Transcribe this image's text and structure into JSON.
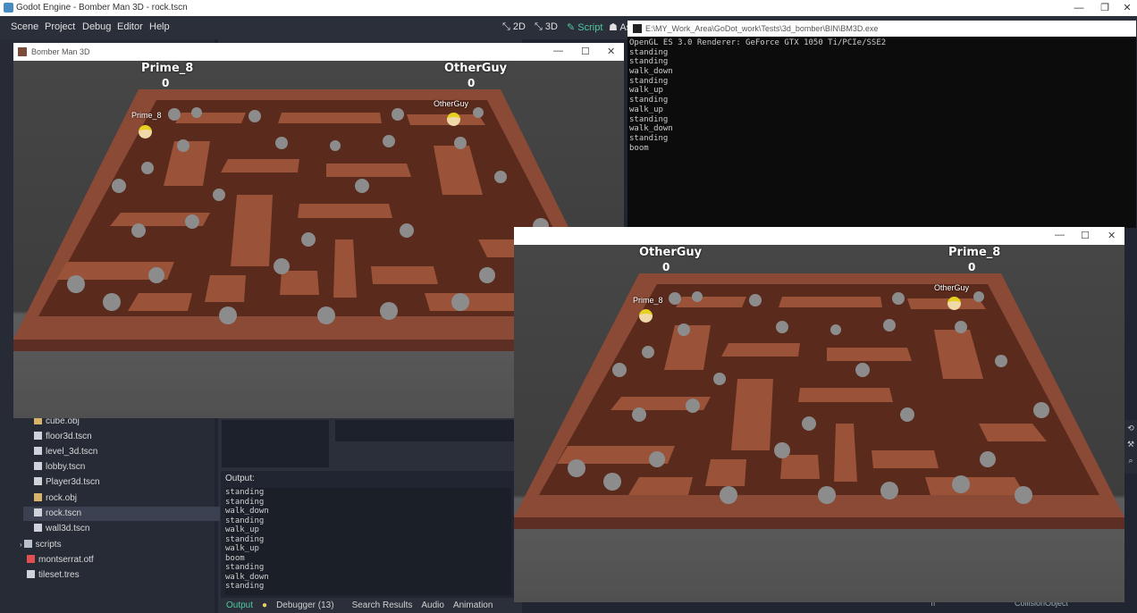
{
  "os_window": {
    "title": "Godot Engine - Bomber Man 3D - rock.tscn",
    "min": "—",
    "max": "❐",
    "close": "✕"
  },
  "menu": {
    "items": [
      "Scene",
      "Project",
      "Debug",
      "Editor",
      "Help"
    ]
  },
  "modes": {
    "2d": "2D",
    "3d": "3D",
    "script": "Script",
    "asset": "As"
  },
  "filesystem": {
    "items": [
      {
        "label": "cube.obj",
        "icon": "mesh-icon"
      },
      {
        "label": "floor3d.tscn",
        "icon": "scene-icon"
      },
      {
        "label": "level_3d.tscn",
        "icon": "scene-icon"
      },
      {
        "label": "lobby.tscn",
        "icon": "scene-icon"
      },
      {
        "label": "Player3d.tscn",
        "icon": "scene-icon"
      },
      {
        "label": "rock.obj",
        "icon": "mesh-icon"
      },
      {
        "label": "rock.tscn",
        "icon": "scene-icon",
        "selected": true
      },
      {
        "label": "wall3d.tscn",
        "icon": "scene-icon"
      },
      {
        "label": "scripts",
        "icon": "folder-icon"
      },
      {
        "label": "montserrat.otf",
        "icon": "font-icon"
      },
      {
        "label": "tileset.tres",
        "icon": "resource-icon"
      }
    ]
  },
  "output": {
    "title": "Output:",
    "lines": [
      "standing",
      "standing",
      "walk_down",
      "standing",
      "walk_up",
      "standing",
      "walk_up",
      "boom",
      "standing",
      "walk_down",
      "standing"
    ]
  },
  "bottom_tabs": {
    "output": "Output",
    "debugger": "Debugger (13)",
    "search": "Search Results",
    "audio": "Audio",
    "animation": "Animation"
  },
  "game1": {
    "title": "Bomber Man 3D",
    "p1_name": "Prime_8",
    "p1_score": "0",
    "p2_name": "OtherGuy",
    "p2_score": "0",
    "label_a": "Prime_8",
    "label_b": "OtherGuy"
  },
  "game2": {
    "p1_name": "OtherGuy",
    "p1_score": "0",
    "p2_name": "Prime_8",
    "p2_score": "0",
    "label_a": "Prime_8",
    "label_b": "OtherGuy"
  },
  "console": {
    "title": "E:\\MY_Work_Area\\GoDot_work\\Tests\\3d_bomber\\BIN\\BM3D.exe",
    "lines": [
      "OpenGL ES 3.0 Renderer: GeForce GTX 1050 Ti/PCIe/SSE2",
      "standing",
      "standing",
      "walk_down",
      "standing",
      "walk_up",
      "standing",
      "walk_up",
      "standing",
      "walk_down",
      "standing",
      "boom"
    ]
  },
  "inspector": {
    "collision_label": "CollisionObject"
  },
  "colors": {
    "brick": "#8a4a35",
    "floor": "#5a2a1c",
    "rock": "#9a9a9a",
    "accent": "#4ec9a0"
  }
}
